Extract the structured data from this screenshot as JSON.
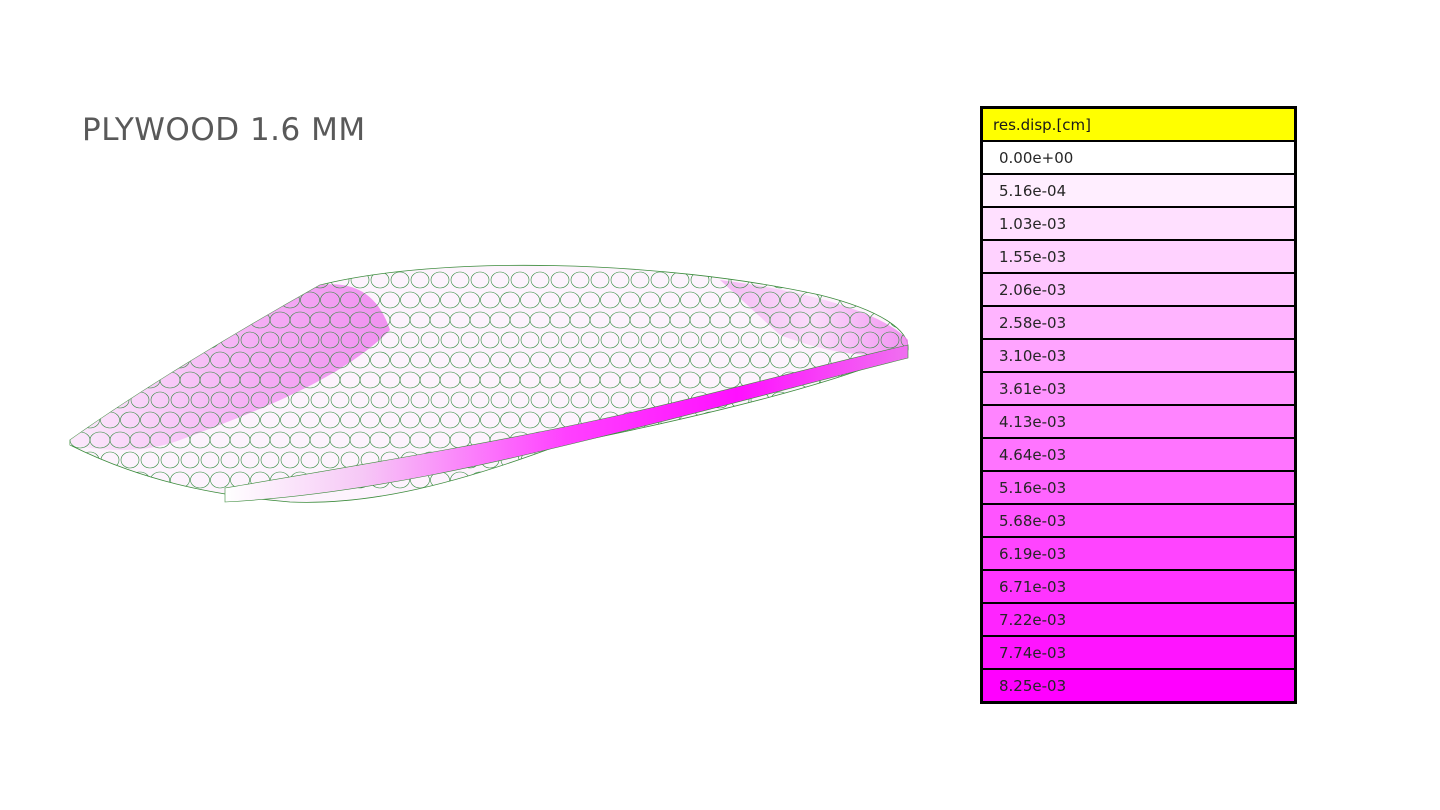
{
  "title": "PLYWOOD 1.6 MM",
  "model": {
    "mesh_color": "#2e8b3a",
    "max_color": "#ff10ff",
    "min_color": "#ffffff"
  },
  "legend": {
    "header": "res.disp.[cm]",
    "header_color": "#ffff00",
    "rows": [
      {
        "label": "0.00e+00",
        "color": "#ffffff"
      },
      {
        "label": "5.16e-04",
        "color": "#ffeeff"
      },
      {
        "label": "1.03e-03",
        "color": "#ffe0ff"
      },
      {
        "label": "1.55e-03",
        "color": "#ffd2ff"
      },
      {
        "label": "2.06e-03",
        "color": "#ffc4ff"
      },
      {
        "label": "2.58e-03",
        "color": "#ffb4ff"
      },
      {
        "label": "3.10e-03",
        "color": "#ffa4ff"
      },
      {
        "label": "3.61e-03",
        "color": "#ff94ff"
      },
      {
        "label": "4.13e-03",
        "color": "#ff84ff"
      },
      {
        "label": "4.64e-03",
        "color": "#ff74ff"
      },
      {
        "label": "5.16e-03",
        "color": "#ff64ff"
      },
      {
        "label": "5.68e-03",
        "color": "#ff54ff"
      },
      {
        "label": "6.19e-03",
        "color": "#ff44ff"
      },
      {
        "label": "6.71e-03",
        "color": "#ff34ff"
      },
      {
        "label": "7.22e-03",
        "color": "#ff24ff"
      },
      {
        "label": "7.74e-03",
        "color": "#ff14ff"
      },
      {
        "label": "8.25e-03",
        "color": "#ff00ff"
      }
    ]
  }
}
